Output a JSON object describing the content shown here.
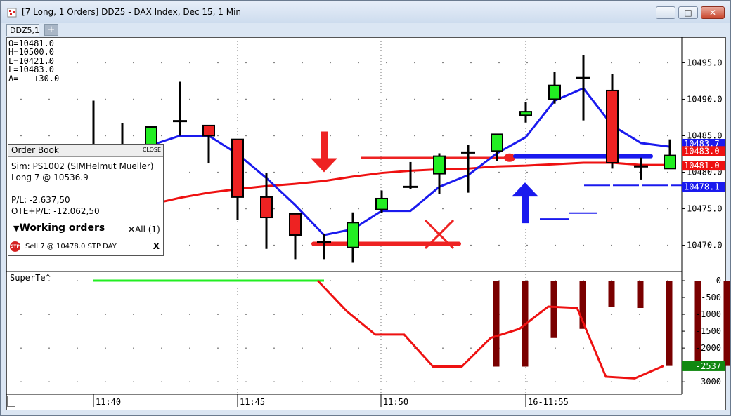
{
  "window": {
    "title": "[7 Long, 1 Orders]  DDZ5 - DAX Index, Dec 15, 1 Min",
    "minimize_label": "–",
    "maximize_label": "□",
    "close_label": "✕"
  },
  "tabs": [
    {
      "label": "DDZ5,1",
      "close_label": "×"
    }
  ],
  "tab_add_label": "+",
  "ohlc": {
    "open": "O=10481.0",
    "high": "H=10500.0",
    "low": "L=10421.0",
    "last": "L=10483.0",
    "delta": "Δ=   +30.0"
  },
  "order_book": {
    "title": "Order Book",
    "close_label": "CLOSE",
    "account": "Sim: PS1002 (SIMHelmut Mueller)",
    "position": "Long 7 @ 10536.9",
    "pl": "P/L: -2.637,50",
    "ote_pl": "OTE+P/L: -12.062,50",
    "working_orders_label": "Working orders",
    "cancel_all_label": "All (1)",
    "orders": [
      {
        "icon": "STP",
        "text": "Sell  7  @  10478.0  STP DAY",
        "cancel_label": "X"
      }
    ]
  },
  "indicator_label": "SuperTe^",
  "colors": {
    "bull": "#22ee22",
    "bear": "#ee2222",
    "ma_blue": "#1a1aee",
    "ma_red": "#ee1111",
    "trend_green": "#22ee22",
    "histogram": "#7a0000",
    "price_last_bg": "#1a1aee",
    "price_mid_bg": "#ee1111",
    "price_low_bg": "#1a1aee",
    "indicator_last_bg": "#118811"
  },
  "chart_data": [
    {
      "type": "candlestick",
      "x_tick_labels": [
        "11:40",
        "11:45",
        "11:50",
        "16-11:55"
      ],
      "y_tick_labels": [
        "10495.0",
        "10490.0",
        "10485.0",
        "10480.0",
        "10475.0",
        "10470.0"
      ],
      "ylim": [
        10466.5,
        10498.5
      ],
      "candles": [
        {
          "o": 10482.0,
          "h": 10489.8,
          "l": 10482.0,
          "c": 10482.0,
          "color": "none"
        },
        {
          "o": 10483.2,
          "h": 10486.7,
          "l": 10482.0,
          "c": 10483.7,
          "color": "red"
        },
        {
          "o": 10483.8,
          "h": 10484.5,
          "l": 10483.0,
          "c": 10486.2,
          "color": "green"
        },
        {
          "o": 10487.0,
          "h": 10492.4,
          "l": 10485.0,
          "c": 10487.0,
          "color": "none"
        },
        {
          "o": 10486.4,
          "h": 10486.4,
          "l": 10481.2,
          "c": 10485.0,
          "color": "red"
        },
        {
          "o": 10484.5,
          "h": 10484.5,
          "l": 10473.5,
          "c": 10476.6,
          "color": "red"
        },
        {
          "o": 10476.6,
          "h": 10479.9,
          "l": 10469.5,
          "c": 10473.8,
          "color": "red"
        },
        {
          "o": 10471.4,
          "h": 10474.3,
          "l": 10468.1,
          "c": 10474.3,
          "color": "red"
        },
        {
          "o": 10470.4,
          "h": 10471.6,
          "l": 10468.1,
          "c": 10470.4,
          "color": "none"
        },
        {
          "o": 10469.7,
          "h": 10474.5,
          "l": 10467.6,
          "c": 10473.1,
          "color": "green"
        },
        {
          "o": 10474.9,
          "h": 10477.5,
          "l": 10474.4,
          "c": 10476.4,
          "color": "green"
        },
        {
          "o": 10478.0,
          "h": 10481.4,
          "l": 10477.7,
          "c": 10478.0,
          "color": "none"
        },
        {
          "o": 10479.8,
          "h": 10482.6,
          "l": 10477.0,
          "c": 10482.2,
          "color": "green"
        },
        {
          "o": 10482.7,
          "h": 10483.7,
          "l": 10477.2,
          "c": 10482.7,
          "color": "none"
        },
        {
          "o": 10482.9,
          "h": 10485.2,
          "l": 10481.5,
          "c": 10485.2,
          "color": "green"
        },
        {
          "o": 10487.8,
          "h": 10489.6,
          "l": 10486.8,
          "c": 10488.3,
          "color": "green"
        },
        {
          "o": 10490.0,
          "h": 10493.7,
          "l": 10489.4,
          "c": 10491.9,
          "color": "green"
        },
        {
          "o": 10492.9,
          "h": 10496.1,
          "l": 10487.1,
          "c": 10492.9,
          "color": "none"
        },
        {
          "o": 10491.2,
          "h": 10493.5,
          "l": 10480.5,
          "c": 10481.3,
          "color": "red"
        },
        {
          "o": 10480.8,
          "h": 10482.0,
          "l": 10479.0,
          "c": 10480.8,
          "color": "none"
        },
        {
          "o": 10480.5,
          "h": 10484.5,
          "l": 10480.5,
          "c": 10482.3,
          "color": "green"
        }
      ],
      "ma_blue": [
        10482.0,
        10483.0,
        10483.7,
        10485.0,
        10485.0,
        10482.5,
        10479.2,
        10475.5,
        10471.4,
        10472.2,
        10474.7,
        10474.7,
        10478.0,
        10479.6,
        10482.6,
        10484.8,
        10489.8,
        10491.5,
        10486.4,
        10484.0,
        10483.5
      ],
      "ma_red": [
        10474.4,
        10475.0,
        10475.6,
        10476.5,
        10477.2,
        10477.7,
        10478.1,
        10478.4,
        10478.8,
        10479.4,
        10479.9,
        10480.2,
        10480.4,
        10480.5,
        10480.8,
        10480.9,
        10481.1,
        10481.3,
        10481.3,
        10481.0,
        10481.0
      ],
      "price_labels": [
        {
          "text": "10483.7",
          "value": 10483.7
        },
        {
          "text": "10483.0",
          "value": 10483.0
        },
        {
          "text": "10481.0",
          "value": 10481.0
        },
        {
          "text": "10478.1",
          "value": 10478.1
        }
      ],
      "annotations": [
        {
          "type": "down-arrow",
          "x_index": 8,
          "value": 10480.0
        },
        {
          "type": "up-arrow",
          "x_index": 15,
          "value": 10478.5
        },
        {
          "type": "cross",
          "x_index": 12,
          "value": 10471.5
        },
        {
          "type": "horizontal-line-red",
          "from_index": 10,
          "to_index": 14,
          "value": 10482.0
        },
        {
          "type": "horizontal-line-red-thick",
          "from_index": 8,
          "to_index": 13,
          "value": 10470.2
        },
        {
          "type": "horizontal-line-blue-thick",
          "from_index": 15,
          "to_index": 21,
          "value": 10482.2
        },
        {
          "type": "horizontal-line-blue",
          "from_index": 16,
          "to_index": 17,
          "value": 10473.6
        },
        {
          "type": "horizontal-line-blue",
          "from_index": 17,
          "to_index": 18,
          "value": 10474.4
        },
        {
          "type": "horizontal-line-blue-dashed",
          "from_index": 18,
          "to_index": 22,
          "value": 10478.2
        }
      ]
    },
    {
      "type": "line",
      "title": "SuperTe^",
      "y_tick_labels": [
        "0",
        "-500",
        "-1000",
        "-1500",
        "-2000",
        "-2500",
        "-3000"
      ],
      "ylim": [
        -3350,
        250
      ],
      "green_line": [
        0,
        0,
        0,
        0,
        0,
        0,
        0,
        0,
        0
      ],
      "red_line": [
        null,
        null,
        null,
        null,
        null,
        null,
        null,
        null,
        null,
        0,
        -900,
        -1600,
        -1600,
        -2550,
        -2550,
        -1700,
        -1430,
        -770,
        -810,
        -2850,
        -2900,
        -2530
      ],
      "histogram": [
        {
          "x_index": 14,
          "value": -2550
        },
        {
          "x_index": 15,
          "value": -2550
        },
        {
          "x_index": 16,
          "value": -1700
        },
        {
          "x_index": 17,
          "value": -1430
        },
        {
          "x_index": 18,
          "value": -770
        },
        {
          "x_index": 19,
          "value": -810
        },
        {
          "x_index": 20,
          "value": -2530
        },
        {
          "x_index": 21,
          "value": -2530
        },
        {
          "x_index": 22,
          "value": -2530
        }
      ],
      "last_label": {
        "text": "-2537",
        "value": -2537
      }
    }
  ]
}
